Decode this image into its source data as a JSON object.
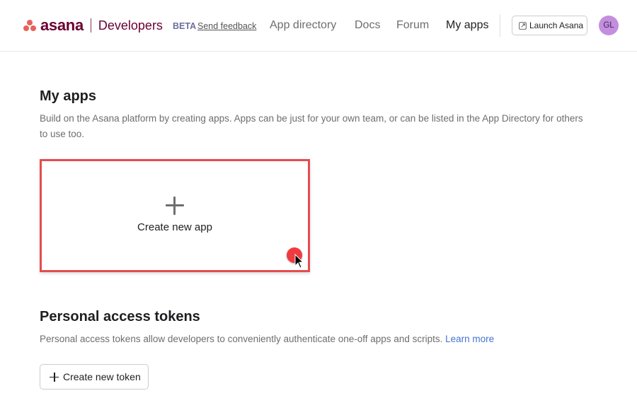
{
  "header": {
    "brand": "asana",
    "product": "Developers",
    "badge": "BETA",
    "feedback_link": "Send feedback",
    "nav": [
      {
        "label": "App directory",
        "active": false
      },
      {
        "label": "Docs",
        "active": false
      },
      {
        "label": "Forum",
        "active": false
      },
      {
        "label": "My apps",
        "active": true
      }
    ],
    "launch_button": "Launch Asana",
    "launch_icon": "external-link-icon",
    "avatar_initials": "GL",
    "avatar_color": "#c38ee0"
  },
  "my_apps": {
    "title": "My apps",
    "description": "Build on the Asana platform by creating apps. Apps can be just for your own team, or can be listed in the App Directory for others to use too.",
    "create_card": {
      "icon": "plus-icon",
      "label": "Create new app",
      "highlight_color": "#e44c4f"
    }
  },
  "tokens": {
    "title": "Personal access tokens",
    "description": "Personal access tokens allow developers to conveniently authenticate one-off apps and scripts.",
    "learn_more": "Learn more",
    "create_button": "Create new token",
    "create_icon": "plus-icon"
  },
  "colors": {
    "brand": "#690031",
    "logo_dots": "#e8615a",
    "link": "#4573d2",
    "click_marker": "#ef3b3f"
  }
}
